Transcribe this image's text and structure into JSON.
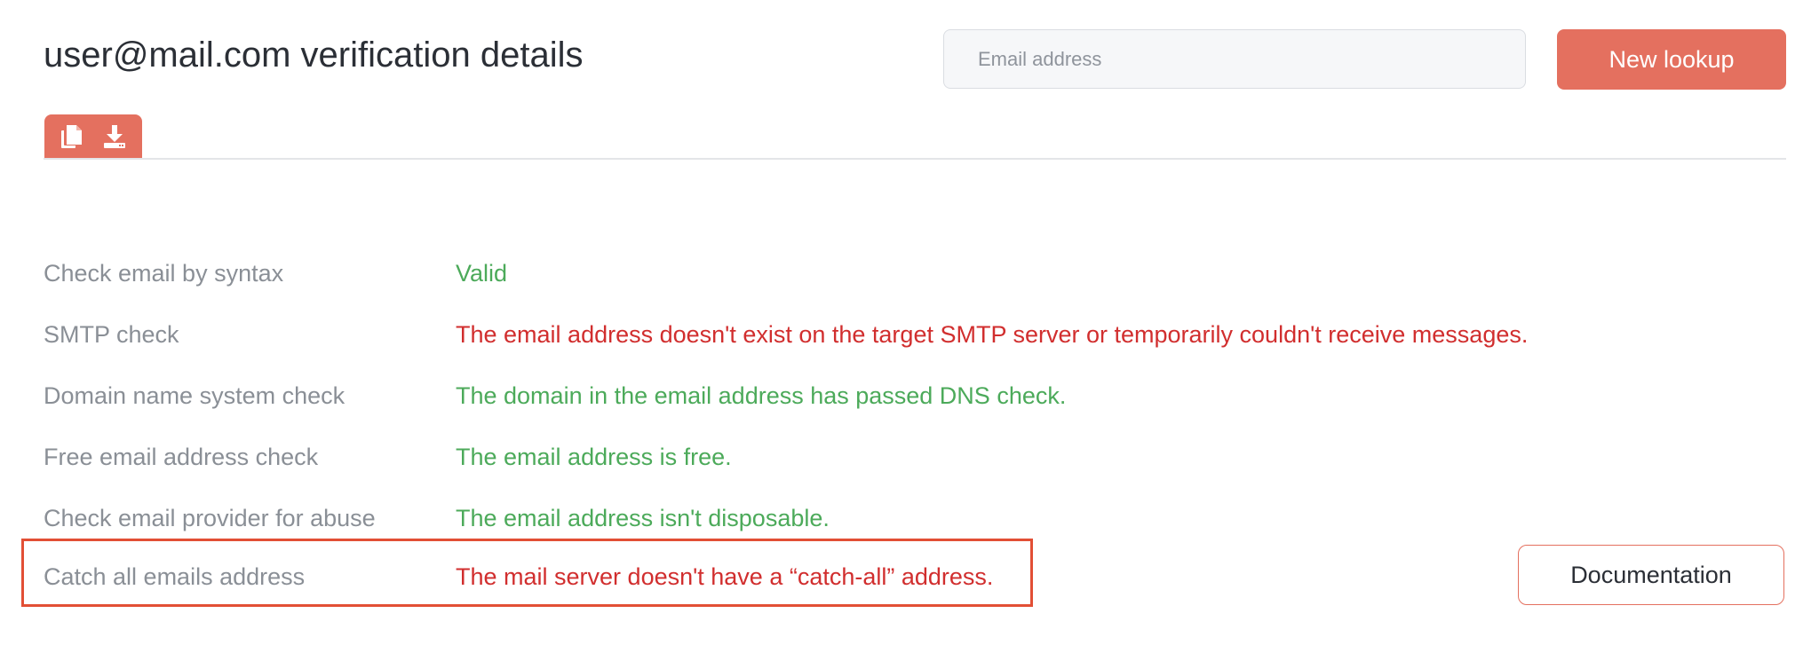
{
  "header": {
    "title": "user@mail.com verification details"
  },
  "search": {
    "placeholder": "Email address",
    "value": ""
  },
  "actions": {
    "new_lookup_label": "New lookup",
    "documentation_label": "Documentation"
  },
  "toolbar": {
    "icons": [
      "copy-icon",
      "download-icon"
    ]
  },
  "colors": {
    "accent": "#e4705f",
    "valid": "#4caa5a",
    "invalid": "#d12e2e",
    "highlight_border": "#e24f35"
  },
  "results": [
    {
      "label": "Check email by syntax",
      "value": "Valid",
      "status": "ok"
    },
    {
      "label": "SMTP check",
      "value": "The email address doesn't exist on the target SMTP server or temporarily couldn't receive messages.",
      "status": "bad"
    },
    {
      "label": "Domain name system check",
      "value": "The domain in the email address has passed DNS check.",
      "status": "ok"
    },
    {
      "label": "Free email address check",
      "value": "The email address is free.",
      "status": "ok"
    },
    {
      "label": "Check email provider for abuse",
      "value": "The email address isn't disposable.",
      "status": "ok"
    },
    {
      "label": "Catch all emails address",
      "value": "The mail server doesn't have a “catch-all” address.",
      "status": "bad",
      "highlighted": true
    }
  ]
}
